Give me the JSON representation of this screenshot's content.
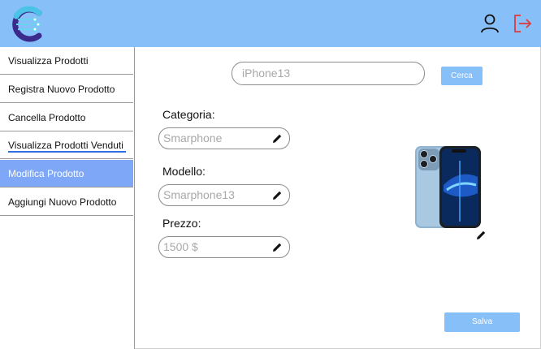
{
  "colors": {
    "accent": "#87bff8",
    "active": "#7ea8f7",
    "logout": "#e03a3a"
  },
  "header": {
    "logo_icon": "c-circuit-logo-icon",
    "user_icon": "user-icon",
    "logout_icon": "logout-icon"
  },
  "sidebar": {
    "items": [
      {
        "label": "Visualizza Prodotti"
      },
      {
        "label": "Registra Nuovo Prodotto"
      },
      {
        "label": "Cancella Prodotto"
      },
      {
        "label": "Visualizza Prodotti Venduti"
      },
      {
        "label": "Modifica Prodotto",
        "active": true
      },
      {
        "label": "Aggiungi Nuovo Prodotto"
      }
    ]
  },
  "search": {
    "value": "iPhone13",
    "button_label": "Cerca"
  },
  "form": {
    "categoria": {
      "label": "Categoria:",
      "value": "Smarphone"
    },
    "modello": {
      "label": "Modello:",
      "value": "Smarphone13"
    },
    "prezzo": {
      "label": "Prezzo:",
      "value": "1500 $"
    }
  },
  "actions": {
    "save_label": "Salva"
  }
}
